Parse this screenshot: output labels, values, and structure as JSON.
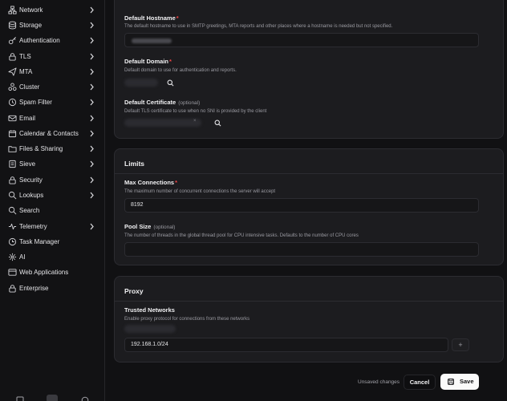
{
  "sidebar": {
    "items": [
      {
        "label": "Network",
        "icon": "network-icon",
        "has_children": true
      },
      {
        "label": "Storage",
        "icon": "database-icon",
        "has_children": true
      },
      {
        "label": "Authentication",
        "icon": "key-icon",
        "has_children": true
      },
      {
        "label": "TLS",
        "icon": "lock-icon",
        "has_children": true
      },
      {
        "label": "MTA",
        "icon": "send-icon",
        "has_children": true
      },
      {
        "label": "Cluster",
        "icon": "cluster-icon",
        "has_children": true
      },
      {
        "label": "Spam Filter",
        "icon": "shield-icon",
        "has_children": true
      },
      {
        "label": "Email",
        "icon": "mail-icon",
        "has_children": true
      },
      {
        "label": "Calendar & Contacts",
        "icon": "calendar-icon",
        "has_children": true
      },
      {
        "label": "Files & Sharing",
        "icon": "folder-icon",
        "has_children": true
      },
      {
        "label": "Sieve",
        "icon": "filter-icon",
        "has_children": true
      },
      {
        "label": "Security",
        "icon": "lock-icon",
        "has_children": true
      },
      {
        "label": "Lookups",
        "icon": "search-icon",
        "has_children": true
      },
      {
        "label": "Search",
        "icon": "search-icon",
        "has_children": false
      },
      {
        "label": "Telemetry",
        "icon": "activity-icon",
        "has_children": true
      },
      {
        "label": "Task Manager",
        "icon": "clock-icon",
        "has_children": false
      },
      {
        "label": "AI",
        "icon": "ai-icon",
        "has_children": false
      },
      {
        "label": "Web Applications",
        "icon": "browser-icon",
        "has_children": false
      },
      {
        "label": "Enterprise",
        "icon": "lock-icon",
        "has_children": false
      }
    ],
    "bottom_icons": [
      "layout-icon",
      "sliders-icon",
      "help-icon"
    ]
  },
  "server_card": {
    "fields": [
      {
        "label": "Default Hostname",
        "required": true,
        "optional_text": "",
        "description": "The default hostname to use in SMTP greetings, MTA reports and other places where a hostname is needed but not specified."
      },
      {
        "label": "Default Domain",
        "required": true,
        "optional_text": "",
        "description": "Default domain to use for authentication and reports."
      },
      {
        "label": "Default Certificate",
        "required": false,
        "optional_text": "(optional)",
        "description": "Default TLS certificate to use when no SNI is provided by the client"
      }
    ]
  },
  "limits_card": {
    "title": "Limits",
    "max_connections": {
      "label": "Max Connections",
      "required": true,
      "description": "The maximum number of concurrent connections the server will accept",
      "value": "8192"
    },
    "pool_size": {
      "label": "Pool Size",
      "optional_text": "(optional)",
      "description": "The number of threads in the global thread pool for CPU intensive tasks. Defaults to the number of CPU cores",
      "value": ""
    }
  },
  "proxy_card": {
    "title": "Proxy",
    "trusted_networks": {
      "label": "Trusted Networks",
      "description": "Enable proxy protocol for connections from these networks",
      "input_value": "192.168.1.0/24",
      "add_label": "+"
    }
  },
  "footer": {
    "unsaved_text": "Unsaved changes",
    "cancel_label": "Cancel",
    "save_label": "Save"
  },
  "colors": {
    "required_marker": "#ef4444",
    "card_bg": "#1c1c1f",
    "page_bg": "#111113"
  }
}
